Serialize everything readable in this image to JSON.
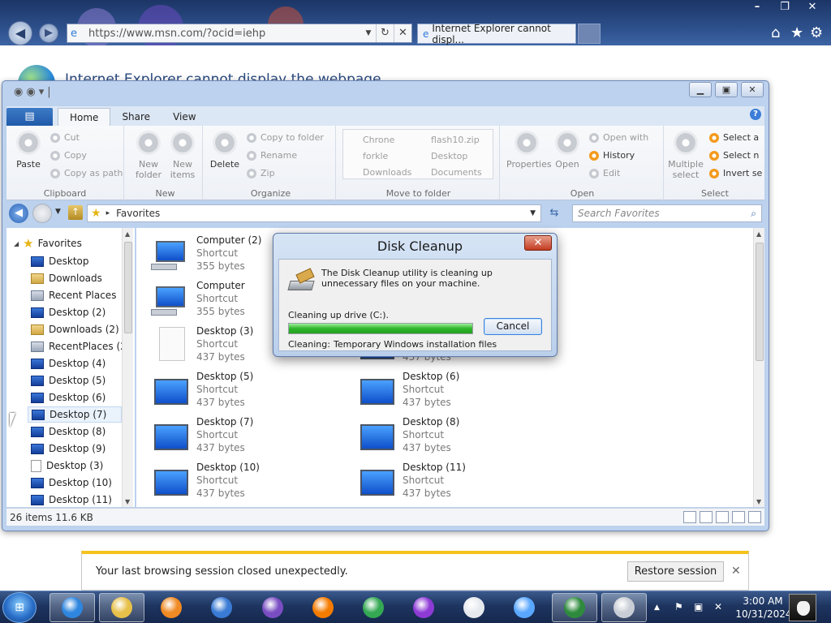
{
  "browser": {
    "url": "https://www.msn.com/?ocid=iehp",
    "tab_title": "Internet Explorer cannot displ...",
    "page_heading": "Internet Explorer cannot display the webpage",
    "window_controls": [
      "–",
      "❐",
      "✕"
    ]
  },
  "explorer": {
    "ribbon_tabs": [
      {
        "label": "Home",
        "active": true
      },
      {
        "label": "Share",
        "active": false
      },
      {
        "label": "View",
        "active": false
      }
    ],
    "clipboard": {
      "paste": "Paste",
      "cut": "Cut",
      "copy": "Copy",
      "copy_path": "Copy as path",
      "label": "Clipboard"
    },
    "new_group": {
      "new_folder": "New folder",
      "new_items": "New items",
      "label": "New"
    },
    "organize": {
      "delete": "Delete",
      "copy_to": "Copy to folder",
      "rename": "Rename",
      "zip": "Zip",
      "label": "Organize"
    },
    "move": {
      "items": [
        "Chrone",
        "forkle",
        "Downloads",
        "flash10.zip",
        "Desktop",
        "Documents"
      ],
      "label": "Move to folder"
    },
    "open_group": {
      "properties": "Properties",
      "open": "Open",
      "open_with": "Open with",
      "history": "History",
      "edit": "Edit",
      "label": "Open"
    },
    "select_group": {
      "multiple_select": "Multiple select",
      "select_all": "Select a",
      "select_none": "Select n",
      "invert": "Invert se",
      "label": "Select"
    },
    "breadcrumb": "Favorites",
    "search_placeholder": "Search Favorites",
    "nav_header": "Favorites",
    "nav_items": [
      {
        "label": "Desktop",
        "icon": "desktop"
      },
      {
        "label": "Downloads",
        "icon": "downloads"
      },
      {
        "label": "Recent Places",
        "icon": "recent"
      },
      {
        "label": "Desktop (2)",
        "icon": "desktop"
      },
      {
        "label": "Downloads (2)",
        "icon": "downloads"
      },
      {
        "label": "RecentPlaces (2)",
        "icon": "recent"
      },
      {
        "label": "Desktop (4)",
        "icon": "desktop"
      },
      {
        "label": "Desktop (5)",
        "icon": "desktop"
      },
      {
        "label": "Desktop (6)",
        "icon": "desktop"
      },
      {
        "label": "Desktop (7)",
        "icon": "desktop",
        "selected": true
      },
      {
        "label": "Desktop (8)",
        "icon": "desktop"
      },
      {
        "label": "Desktop (9)",
        "icon": "desktop"
      },
      {
        "label": "Desktop (3)",
        "icon": "file"
      },
      {
        "label": "Desktop (10)",
        "icon": "desktop"
      },
      {
        "label": "Desktop (11)",
        "icon": "desktop"
      }
    ],
    "files": [
      {
        "name": "Computer (2)",
        "type": "Shortcut",
        "size": "355 bytes",
        "icon": "computer"
      },
      {
        "name": "Computer",
        "type": "Shortcut",
        "size": "355 bytes",
        "icon": "computer"
      },
      {
        "name": "Desktop (3)",
        "type": "Shortcut",
        "size": "437 bytes",
        "icon": "doc"
      },
      {
        "name": "",
        "type": "",
        "size": "437 bytes",
        "icon": "desktop"
      },
      {
        "name": "Desktop (5)",
        "type": "Shortcut",
        "size": "437 bytes",
        "icon": "desktop"
      },
      {
        "name": "Desktop (6)",
        "type": "Shortcut",
        "size": "437 bytes",
        "icon": "desktop"
      },
      {
        "name": "Desktop (7)",
        "type": "Shortcut",
        "size": "437 bytes",
        "icon": "desktop"
      },
      {
        "name": "Desktop (8)",
        "type": "Shortcut",
        "size": "437 bytes",
        "icon": "desktop"
      },
      {
        "name": "Desktop (10)",
        "type": "Shortcut",
        "size": "437 bytes",
        "icon": "desktop"
      },
      {
        "name": "Desktop (11)",
        "type": "Shortcut",
        "size": "437 bytes",
        "icon": "desktop"
      }
    ],
    "status": "26 items 11.6 KB"
  },
  "disk_cleanup": {
    "title": "Disk Cleanup",
    "message": "The Disk Cleanup utility is cleaning up unnecessary files on your machine.",
    "drive_label": "Cleaning up drive  (C:).",
    "progress": 1.0,
    "cancel_label": "Cancel",
    "cleaning_label": "Cleaning:",
    "cleaning_item": "Temporary Windows installation files"
  },
  "notification": {
    "message": "Your last browsing session closed unexpectedly.",
    "restore_label": "Restore session"
  },
  "taskbar": {
    "time": "3:00 AM",
    "date": "10/31/2024",
    "apps": [
      {
        "name": "ie-icon",
        "color": "#2e86de",
        "active": true
      },
      {
        "name": "explorer-icon",
        "color": "#e7c04a",
        "active": true
      },
      {
        "name": "media-player-icon",
        "color": "#f08a24",
        "active": false
      },
      {
        "name": "firefox-blue-icon",
        "color": "#3a7bd5",
        "active": false
      },
      {
        "name": "tor-icon",
        "color": "#7a4ec2",
        "active": false
      },
      {
        "name": "firefox-icon",
        "color": "#f57c00",
        "active": false
      },
      {
        "name": "chrome-icon",
        "color": "#34a853",
        "active": false
      },
      {
        "name": "purple-orb-icon",
        "color": "#8e3bd6",
        "active": false
      },
      {
        "name": "white-orb-icon",
        "color": "#e6e9ee",
        "active": false
      },
      {
        "name": "u-app-icon",
        "color": "#5aa7ff",
        "active": false
      },
      {
        "name": "globe-icon",
        "color": "#2e8b3d",
        "active": true
      },
      {
        "name": "disk-cleanup-icon",
        "color": "#c9ced6",
        "active": true
      }
    ]
  }
}
